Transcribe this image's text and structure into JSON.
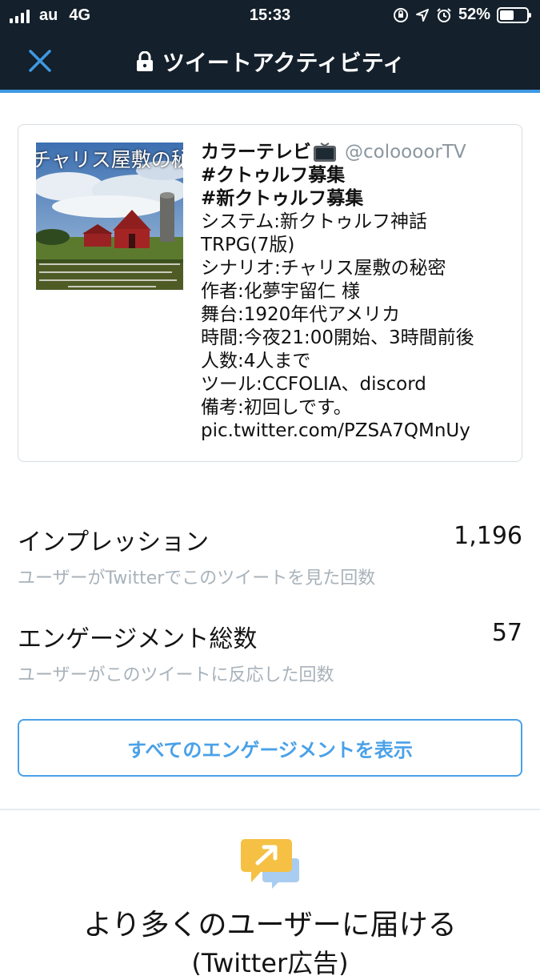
{
  "status_bar": {
    "carrier": "au",
    "network": "4G",
    "time": "15:33",
    "battery": "52%",
    "battery_level": 0.52
  },
  "nav": {
    "title": "ツイートアクティビティ",
    "lock_icon": "lock-icon",
    "close_icon": "close-icon"
  },
  "tweet": {
    "thumbnail_caption": "チャリス屋敷の秘密",
    "author": "カラーテレビ",
    "handle": "@coloooorTV",
    "hashtag1": "#クトゥルフ募集",
    "hashtag2": "#新クトゥルフ募集",
    "lines": [
      "システム:新クトゥルフ神話",
      "TRPG(7版)",
      "シナリオ:チャリス屋敷の秘密",
      "作者:化夢宇留仁 様",
      "舞台:1920年代アメリカ",
      "時間:今夜21:00開始、3時間前後",
      "人数:4人まで",
      "ツール:CCFOLIA、discord",
      "備考:初回しです。",
      "pic.twitter.com/PZSA7QMnUy"
    ]
  },
  "stats": {
    "impressions": {
      "label": "インプレッション",
      "value": "1,196",
      "desc": "ユーザーがTwitterでこのツイートを見た回数"
    },
    "engagements": {
      "label": "エンゲージメント総数",
      "value": "57",
      "desc": "ユーザーがこのツイートに反応した回数"
    }
  },
  "engage_button": "すべてのエンゲージメントを表示",
  "promo": {
    "title": "より多くのユーザーに届ける",
    "subtitle": "(Twitter広告)"
  },
  "colors": {
    "nav_bg": "#14202b",
    "accent": "#4aa1e8"
  }
}
